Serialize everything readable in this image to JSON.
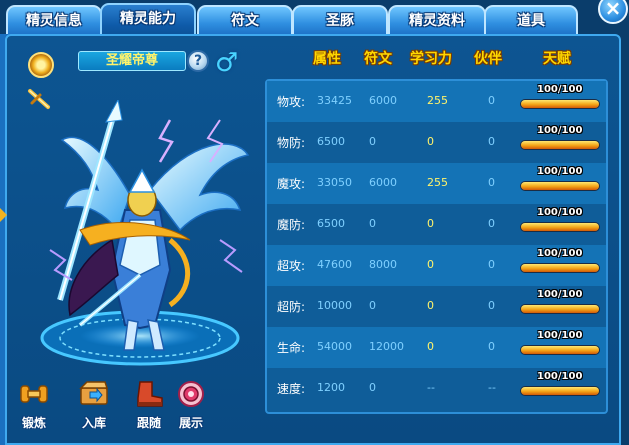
{
  "tabs": [
    {
      "label": "精灵信息",
      "active": false
    },
    {
      "label": "精灵能力",
      "active": true
    },
    {
      "label": "符文",
      "active": false
    },
    {
      "label": "圣豚",
      "active": false
    },
    {
      "label": "精灵资料",
      "active": false
    },
    {
      "label": "道具",
      "active": false
    }
  ],
  "close_label": "×",
  "pet": {
    "name": "圣耀帝尊",
    "help_label": "?",
    "gender_symbol": "♂"
  },
  "columns": [
    "属性",
    "符文",
    "学习力",
    "伙伴",
    "天赋"
  ],
  "stats": [
    {
      "label": "物攻:",
      "value": "33425",
      "rune": "6000",
      "learn": "255",
      "partner": "0",
      "talent": "100/100",
      "talent_fraction": 1.0
    },
    {
      "label": "物防:",
      "value": "6500",
      "rune": "0",
      "learn": "0",
      "partner": "0",
      "talent": "100/100",
      "talent_fraction": 1.0
    },
    {
      "label": "魔攻:",
      "value": "33050",
      "rune": "6000",
      "learn": "255",
      "partner": "0",
      "talent": "100/100",
      "talent_fraction": 1.0
    },
    {
      "label": "魔防:",
      "value": "6500",
      "rune": "0",
      "learn": "0",
      "partner": "0",
      "talent": "100/100",
      "talent_fraction": 1.0
    },
    {
      "label": "超攻:",
      "value": "47600",
      "rune": "8000",
      "learn": "0",
      "partner": "0",
      "talent": "100/100",
      "talent_fraction": 1.0
    },
    {
      "label": "超防:",
      "value": "10000",
      "rune": "0",
      "learn": "0",
      "partner": "0",
      "talent": "100/100",
      "talent_fraction": 1.0
    },
    {
      "label": "生命:",
      "value": "54000",
      "rune": "12000",
      "learn": "0",
      "partner": "0",
      "talent": "100/100",
      "talent_fraction": 1.0
    },
    {
      "label": "速度:",
      "value": "1200",
      "rune": "0",
      "learn": "--",
      "partner": "--",
      "talent": "100/100",
      "talent_fraction": 1.0
    }
  ],
  "actions": [
    {
      "label": "锻炼",
      "icon": "dumbbell-icon",
      "color": "#f0a020"
    },
    {
      "label": "入库",
      "icon": "storage-box-icon",
      "color": "#e8a040"
    },
    {
      "label": "跟随",
      "icon": "follow-boot-icon",
      "color": "#d84a2a"
    },
    {
      "label": "展示",
      "icon": "display-badge-icon",
      "color": "#e03a6a"
    }
  ],
  "colors": {
    "header_yellow": "#ffd800",
    "learn_yellow": "#fff36b",
    "value_blue": "#7fd0ff"
  }
}
